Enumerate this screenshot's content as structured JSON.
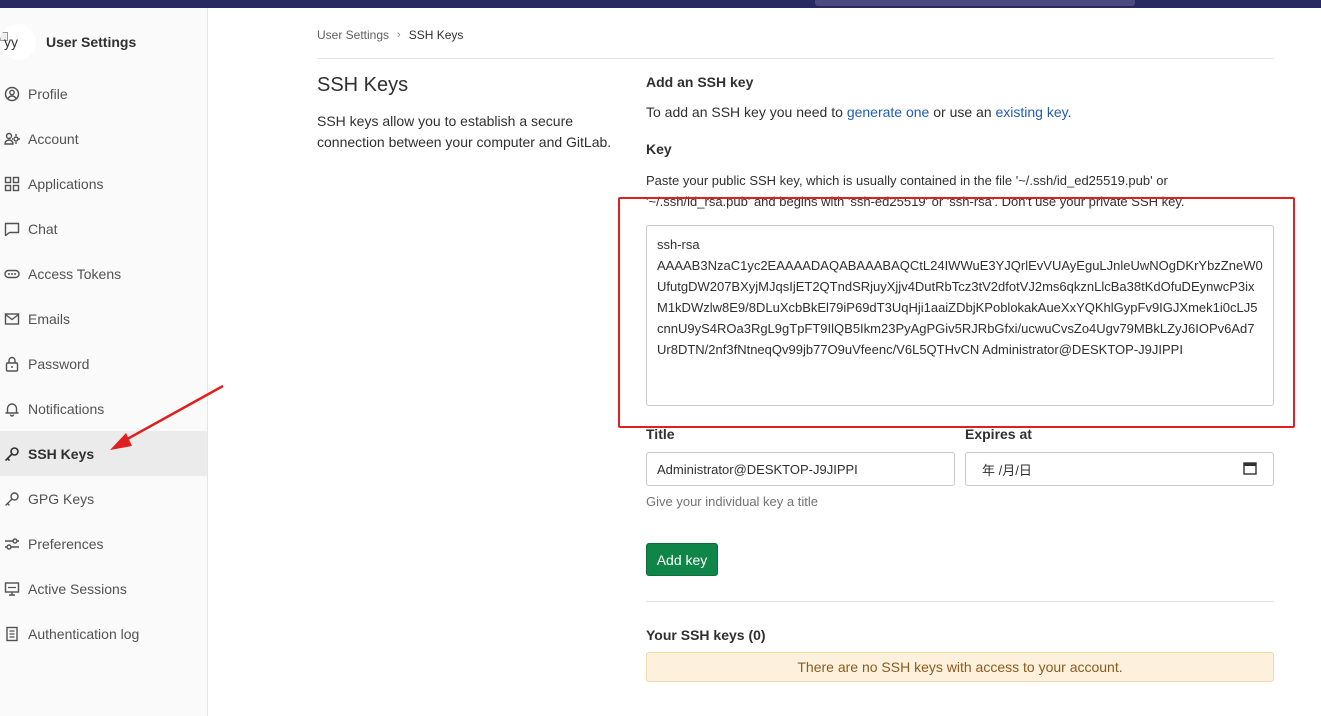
{
  "sidebar": {
    "title": "User Settings",
    "avatar_alt": "yy",
    "items": [
      {
        "label": "Profile",
        "icon": "profile-icon"
      },
      {
        "label": "Account",
        "icon": "account-icon"
      },
      {
        "label": "Applications",
        "icon": "applications-icon"
      },
      {
        "label": "Chat",
        "icon": "chat-icon"
      },
      {
        "label": "Access Tokens",
        "icon": "token-icon"
      },
      {
        "label": "Emails",
        "icon": "mail-icon"
      },
      {
        "label": "Password",
        "icon": "lock-icon"
      },
      {
        "label": "Notifications",
        "icon": "bell-icon"
      },
      {
        "label": "SSH Keys",
        "icon": "key-icon"
      },
      {
        "label": "GPG Keys",
        "icon": "key-icon"
      },
      {
        "label": "Preferences",
        "icon": "preferences-icon"
      },
      {
        "label": "Active Sessions",
        "icon": "monitor-icon"
      },
      {
        "label": "Authentication log",
        "icon": "log-icon"
      }
    ],
    "active_item": "SSH Keys"
  },
  "breadcrumb": {
    "parent": "User Settings",
    "separator": "›",
    "current": "SSH Keys"
  },
  "section": {
    "title": "SSH Keys",
    "description": "SSH keys allow you to establish a secure connection between your computer and GitLab."
  },
  "form": {
    "heading": "Add an SSH key",
    "intro_prefix": "To add an SSH key you need to ",
    "intro_link1": "generate one",
    "intro_middle": " or use an ",
    "intro_link2": "existing key",
    "intro_suffix": ".",
    "key_label": "Key",
    "key_help": "Paste your public SSH key, which is usually contained in the file '~/.ssh/id_ed25519.pub' or '~/.ssh/id_rsa.pub' and begins with 'ssh-ed25519' or 'ssh-rsa'. Don't use your private SSH key.",
    "key_value": "ssh-rsa\nAAAAB3NzaC1yc2EAAAADAQABAAABAQCtL24IWWuE3YJQrlEvVUAyEguLJnleUwNOgDKrYbzZneW0UfutgDW207BXyjMJqsIjET2QTndSRjuyXjjv4DutRbTcz3tV2dfotVJ2ms6qkznLlcBa38tKdOfuDEynwcP3ixM1kDWzlw8E9/8DLuXcbBkEl79iP69dT3UqHji1aaiZDbjKPoblokakAueXxYQKhlGypFv9IGJXmek1i0cLJ5cnnU9yS4ROa3RgL9gTpFT9IlQB5Ikm23PyAgPGiv5RJRbGfxi/ucwuCvsZo4Ugv79MBkLZyJ6IOPv6Ad7Ur8DTN/2nf3fNtneqQv99jb77O9uVfeenc/V6L5QTHvCN Administrator@DESKTOP-J9JIPPI",
    "title_label": "Title",
    "title_value": "Administrator@DESKTOP-J9JIPPI",
    "title_help": "Give your individual key a title",
    "expires_label": "Expires at",
    "expires_placeholder": "年 /月/日",
    "submit_label": "Add key"
  },
  "keys_list": {
    "heading": "Your SSH keys (0)",
    "empty_message": "There are no SSH keys with access to your account."
  },
  "colors": {
    "topbar": "#292961",
    "primary_button": "#108548",
    "link": "#1f5db3",
    "annotation": "#e02020",
    "alert_bg": "#fdf1dd"
  }
}
